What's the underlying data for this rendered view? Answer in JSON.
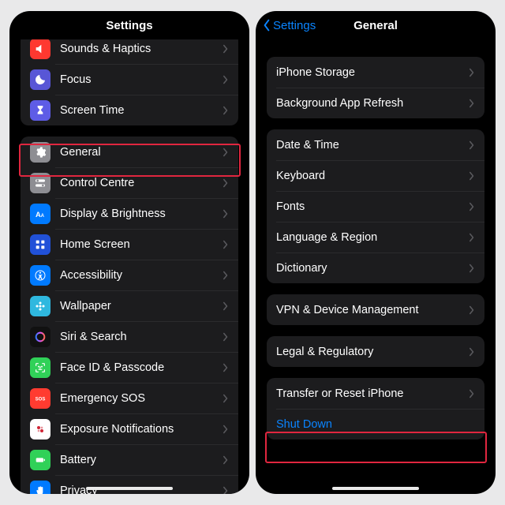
{
  "left": {
    "title": "Settings",
    "group1": [
      {
        "label": "Sounds & Haptics",
        "icon": "speaker-icon",
        "color": "c-red"
      },
      {
        "label": "Focus",
        "icon": "moon-icon",
        "color": "c-violet"
      },
      {
        "label": "Screen Time",
        "icon": "hourglass-icon",
        "color": "c-purple"
      }
    ],
    "group2": [
      {
        "label": "General",
        "icon": "gear-icon",
        "color": "c-gray"
      },
      {
        "label": "Control Centre",
        "icon": "switches-icon",
        "color": "c-gray"
      },
      {
        "label": "Display & Brightness",
        "icon": "text-size-icon",
        "color": "c-blue"
      },
      {
        "label": "Home Screen",
        "icon": "grid-icon",
        "color": "c-darkblue"
      },
      {
        "label": "Accessibility",
        "icon": "accessibility-icon",
        "color": "c-blue"
      },
      {
        "label": "Wallpaper",
        "icon": "flower-icon",
        "color": "c-cyan"
      },
      {
        "label": "Siri & Search",
        "icon": "siri-icon",
        "color": "c-black"
      },
      {
        "label": "Face ID & Passcode",
        "icon": "faceid-icon",
        "color": "c-green"
      },
      {
        "label": "Emergency SOS",
        "icon": "sos-icon",
        "color": "c-sos"
      },
      {
        "label": "Exposure Notifications",
        "icon": "exposure-icon",
        "color": "c-white"
      },
      {
        "label": "Battery",
        "icon": "battery-icon",
        "color": "c-green"
      },
      {
        "label": "Privacy",
        "icon": "hand-icon",
        "color": "c-blue"
      }
    ]
  },
  "right": {
    "back": "Settings",
    "title": "General",
    "groupA": [
      {
        "label": "iPhone Storage"
      },
      {
        "label": "Background App Refresh"
      }
    ],
    "groupB": [
      {
        "label": "Date & Time"
      },
      {
        "label": "Keyboard"
      },
      {
        "label": "Fonts"
      },
      {
        "label": "Language & Region"
      },
      {
        "label": "Dictionary"
      }
    ],
    "groupC": [
      {
        "label": "VPN & Device Management"
      }
    ],
    "groupD": [
      {
        "label": "Legal & Regulatory"
      }
    ],
    "groupE": [
      {
        "label": "Transfer or Reset iPhone"
      },
      {
        "label": "Shut Down",
        "link": true,
        "nochev": true
      }
    ]
  }
}
